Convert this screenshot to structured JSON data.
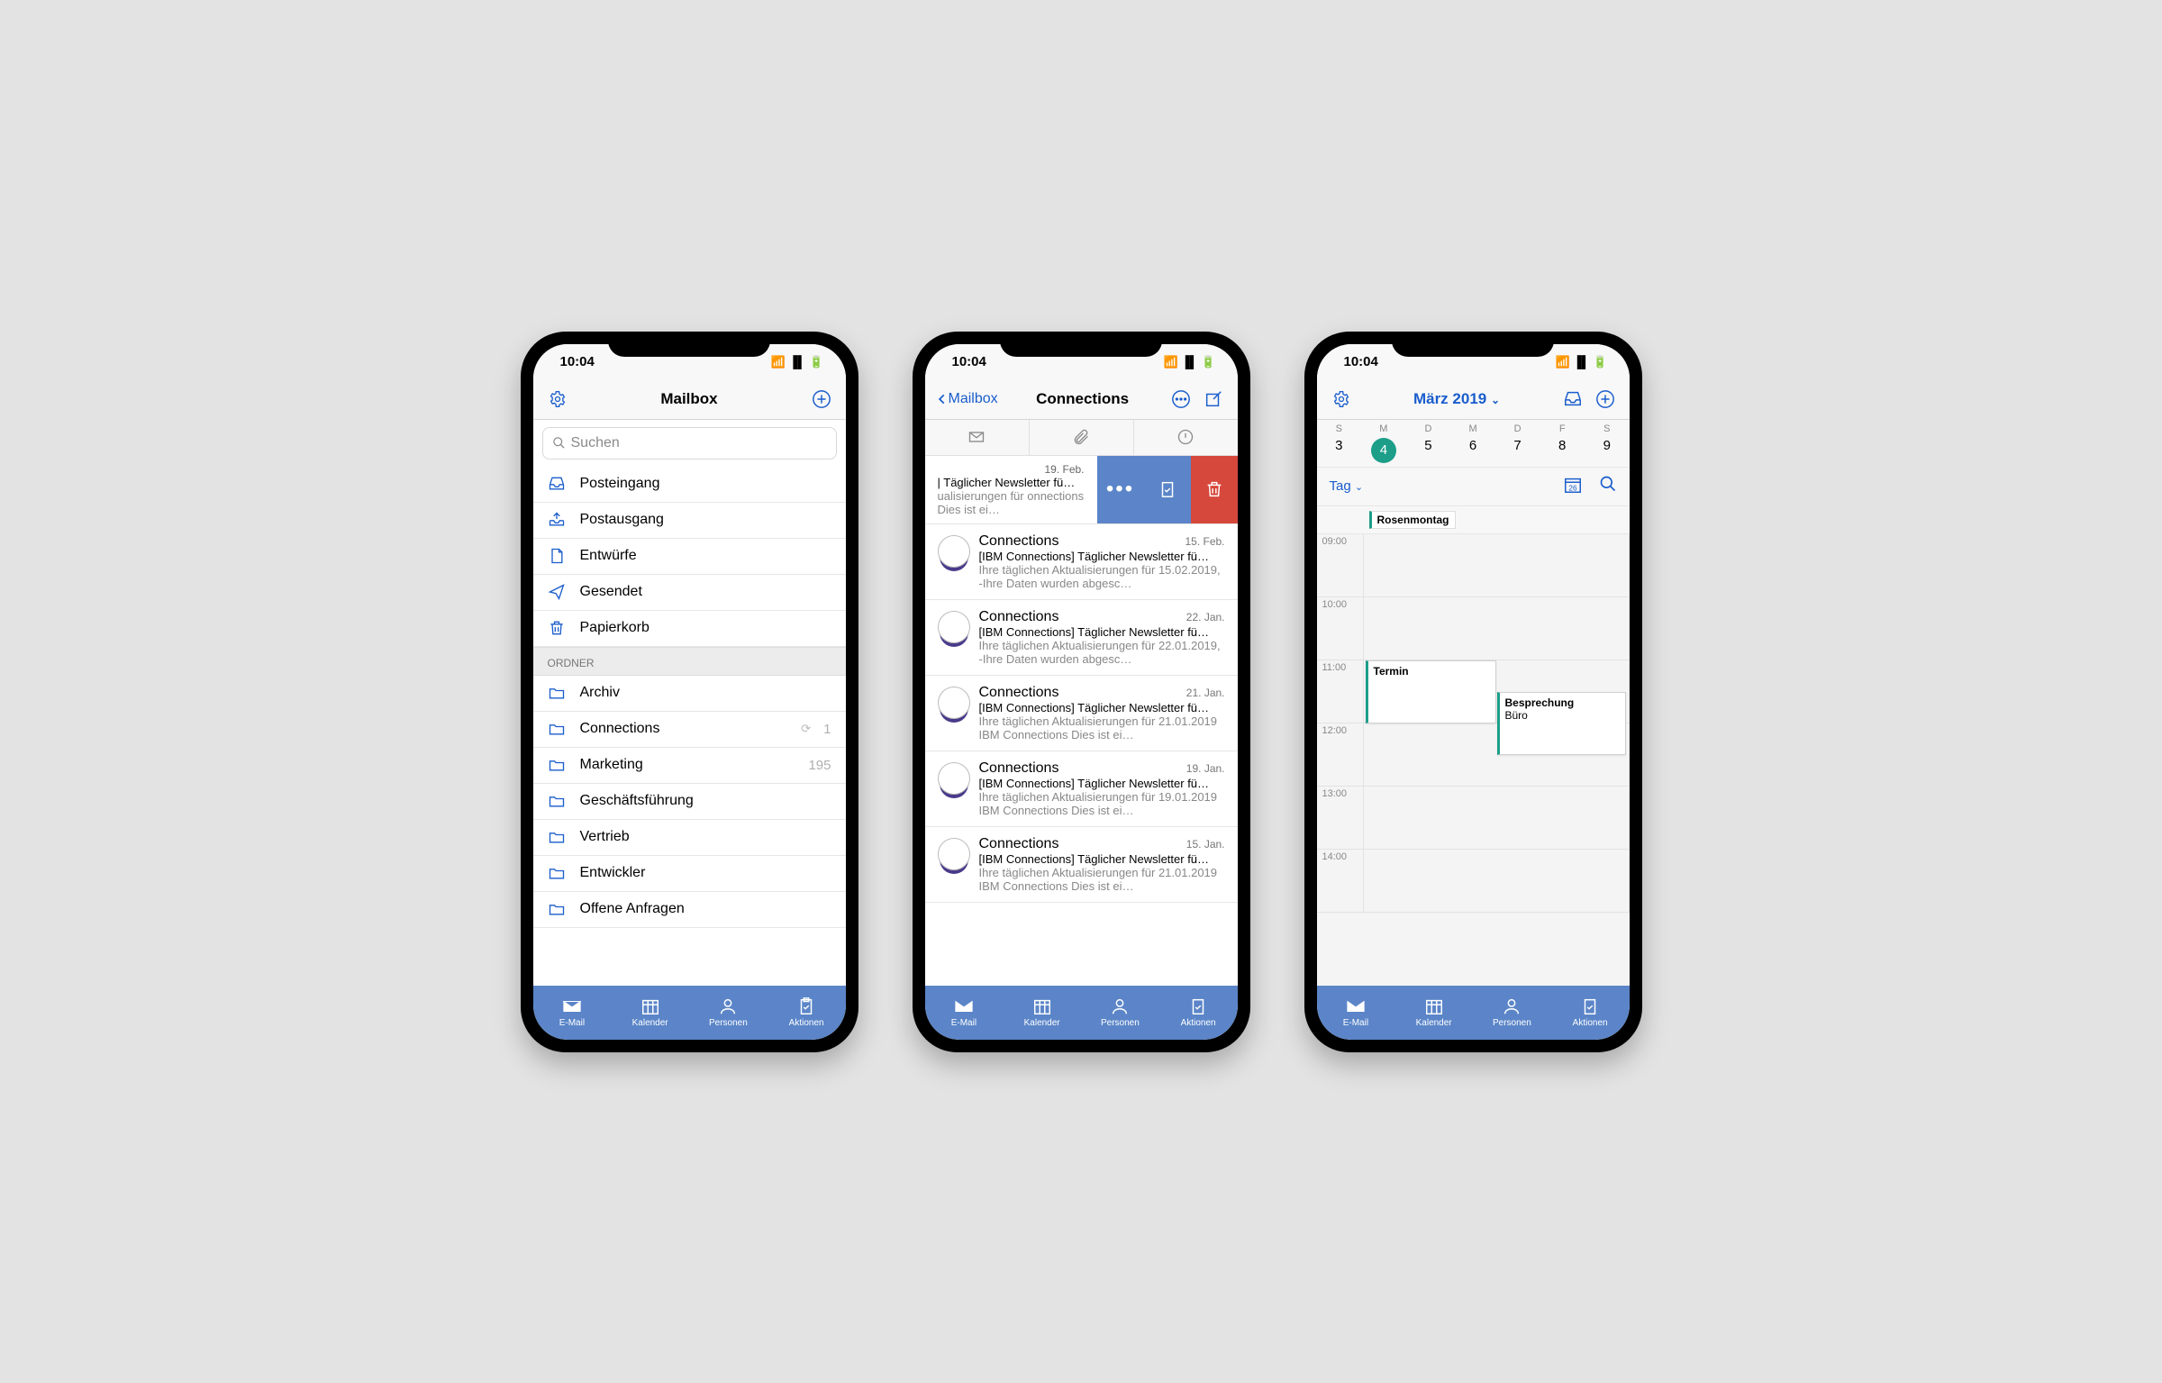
{
  "statusbar": {
    "time": "10:04"
  },
  "tabbar": {
    "email": "E-Mail",
    "calendar": "Kalender",
    "people": "Personen",
    "actions": "Aktionen"
  },
  "phone1": {
    "title": "Mailbox",
    "search_placeholder": "Suchen",
    "main_folders": [
      {
        "label": "Posteingang"
      },
      {
        "label": "Postausgang"
      },
      {
        "label": "Entwürfe"
      },
      {
        "label": "Gesendet"
      },
      {
        "label": "Papierkorb"
      }
    ],
    "section_label": "ORDNER",
    "folders": [
      {
        "label": "Archiv",
        "count": ""
      },
      {
        "label": "Connections",
        "count": "1"
      },
      {
        "label": "Marketing",
        "count": "195"
      },
      {
        "label": "Geschäftsführung",
        "count": ""
      },
      {
        "label": "Vertrieb",
        "count": ""
      },
      {
        "label": "Entwickler",
        "count": ""
      },
      {
        "label": "Offene Anfragen",
        "count": ""
      }
    ]
  },
  "phone2": {
    "back_label": "Mailbox",
    "title": "Connections",
    "swiped": {
      "date": "19. Feb.",
      "subject": "| Täglicher Newsletter fü…",
      "preview": "ualisierungen für onnections Dies ist ei…"
    },
    "emails": [
      {
        "sender": "Connections",
        "date": "15. Feb.",
        "subject": "[IBM Connections] Täglicher Newsletter fü…",
        "preview": "Ihre täglichen Aktualisierungen für 15.02.2019, -Ihre Daten wurden abgesc…"
      },
      {
        "sender": "Connections",
        "date": "22. Jan.",
        "subject": "[IBM Connections] Täglicher Newsletter fü…",
        "preview": "Ihre täglichen Aktualisierungen für 22.01.2019, -Ihre Daten wurden abgesc…"
      },
      {
        "sender": "Connections",
        "date": "21. Jan.",
        "subject": "[IBM Connections] Täglicher Newsletter fü…",
        "preview": "Ihre täglichen Aktualisierungen für 21.01.2019 IBM Connections Dies ist ei…"
      },
      {
        "sender": "Connections",
        "date": "19. Jan.",
        "subject": "[IBM Connections] Täglicher Newsletter fü…",
        "preview": "Ihre täglichen Aktualisierungen für 19.01.2019 IBM Connections Dies ist ei…"
      },
      {
        "sender": "Connections",
        "date": "15. Jan.",
        "subject": "[IBM Connections] Täglicher Newsletter fü…",
        "preview": "Ihre täglichen Aktualisierungen für 21.01.2019 IBM Connections Dies ist ei…"
      }
    ]
  },
  "phone3": {
    "month_label": "März 2019",
    "view_label": "Tag",
    "days_of_week": [
      "S",
      "M",
      "D",
      "M",
      "D",
      "F",
      "S"
    ],
    "dates": [
      "3",
      "4",
      "5",
      "6",
      "7",
      "8",
      "9"
    ],
    "selected_index": 1,
    "allday_event": "Rosenmontag",
    "hours": [
      "09:00",
      "10:00",
      "11:00",
      "12:00",
      "13:00",
      "14:00"
    ],
    "events": [
      {
        "title": "Termin",
        "sub": ""
      },
      {
        "title": "Besprechung",
        "sub": "Büro"
      }
    ]
  }
}
